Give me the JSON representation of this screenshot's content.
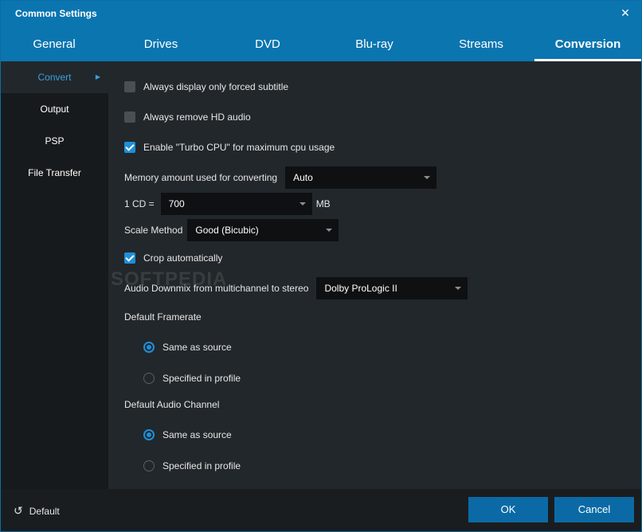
{
  "window": {
    "title": "Common Settings",
    "close_glyph": "✕"
  },
  "tabs": [
    {
      "label": "General"
    },
    {
      "label": "Drives"
    },
    {
      "label": "DVD"
    },
    {
      "label": "Blu-ray"
    },
    {
      "label": "Streams"
    },
    {
      "label": "Conversion",
      "active": true
    }
  ],
  "sidebar": {
    "items": [
      {
        "label": "Convert",
        "active": true
      },
      {
        "label": "Output"
      },
      {
        "label": "PSP"
      },
      {
        "label": "File Transfer"
      }
    ]
  },
  "settings": {
    "forced_subtitle": {
      "label": "Always display only forced subtitle",
      "checked": false
    },
    "remove_hd_audio": {
      "label": "Always remove HD audio",
      "checked": false
    },
    "turbo_cpu": {
      "label": "Enable \"Turbo CPU\" for maximum cpu usage",
      "checked": true
    },
    "memory": {
      "label": "Memory amount used for converting",
      "value": "Auto"
    },
    "cd_size": {
      "label": "1 CD =",
      "value": "700",
      "unit": "MB"
    },
    "scale_method": {
      "label": "Scale Method",
      "value": "Good (Bicubic)"
    },
    "crop_auto": {
      "label": "Crop automatically",
      "checked": true
    },
    "audio_downmix": {
      "label": "Audio Downmix from multichannel to stereo",
      "value": "Dolby ProLogic II"
    },
    "default_framerate": {
      "label": "Default Framerate",
      "options": [
        {
          "label": "Same as source",
          "selected": true
        },
        {
          "label": "Specified in profile",
          "selected": false
        }
      ]
    },
    "default_audio_channel": {
      "label": "Default Audio Channel",
      "options": [
        {
          "label": "Same as source",
          "selected": true
        },
        {
          "label": "Specified in profile",
          "selected": false
        }
      ]
    }
  },
  "watermark": "SOFTPEDIA",
  "footer": {
    "default_label": "Default",
    "default_icon": "↺",
    "ok_label": "OK",
    "cancel_label": "Cancel"
  },
  "colors": {
    "accent": "#0b75b0",
    "check": "#1e8fd8",
    "button": "#0b6aa5"
  }
}
